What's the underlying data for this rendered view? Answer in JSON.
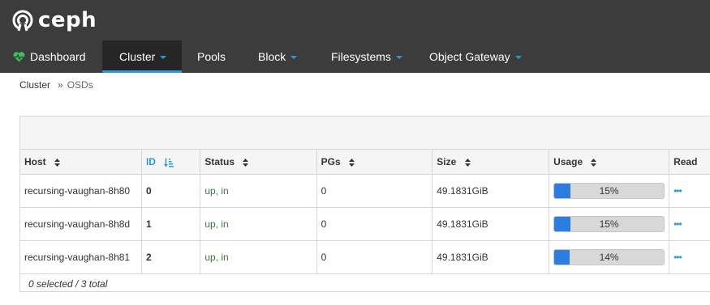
{
  "brand": {
    "name": "ceph"
  },
  "nav": {
    "items": [
      {
        "label": "Dashboard"
      },
      {
        "label": "Cluster"
      },
      {
        "label": "Pools"
      },
      {
        "label": "Block"
      },
      {
        "label": "Filesystems"
      },
      {
        "label": "Object Gateway"
      }
    ],
    "active": "Cluster"
  },
  "breadcrumb": {
    "parent": "Cluster",
    "separator": "»",
    "current": "OSDs"
  },
  "table": {
    "columns": [
      "Host",
      "ID",
      "Status",
      "PGs",
      "Size",
      "Usage",
      "Read"
    ],
    "sorted_column": "ID",
    "rows": [
      {
        "host": "recursing-vaughan-8h80",
        "id": "0",
        "status": "up, in",
        "pgs": "0",
        "size": "49.1831GiB",
        "usage": "15%",
        "usage_value": 15
      },
      {
        "host": "recursing-vaughan-8h8d",
        "id": "1",
        "status": "up, in",
        "pgs": "0",
        "size": "49.1831GiB",
        "usage": "15%",
        "usage_value": 15
      },
      {
        "host": "recursing-vaughan-8h81",
        "id": "2",
        "status": "up, in",
        "pgs": "0",
        "size": "49.1831GiB",
        "usage": "14%",
        "usage_value": 14
      }
    ],
    "footer": "0 selected / 3 total"
  },
  "colors": {
    "header_bg": "#3d3c3c",
    "accent": "#2b99d6",
    "status_ok": "#3c763d",
    "heart": "#3fbf5f"
  },
  "icons": {
    "brand": "ceph-logo-icon",
    "dashboard": "heartbeat-icon",
    "dropdown": "caret-down-icon",
    "sort": "sort-icon",
    "sorted": "sort-amount-asc-icon",
    "sparkline": "sparkline-icon"
  }
}
